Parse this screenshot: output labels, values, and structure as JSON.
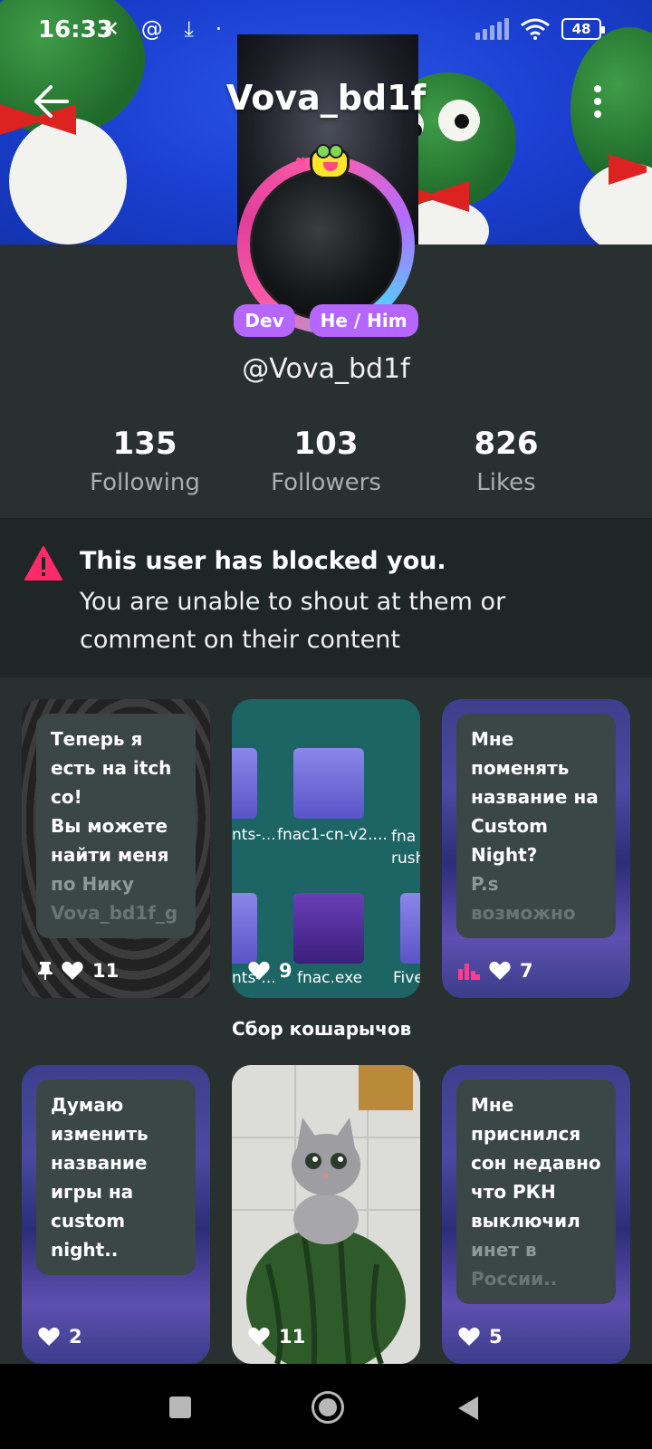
{
  "status_bar": {
    "time": "16:33",
    "left_icons": "✕ @ ⤓ ·",
    "battery": "48"
  },
  "header": {
    "title": "Vova_bd1f"
  },
  "profile": {
    "badges": [
      "Dev",
      "He / Him"
    ],
    "handle": "@Vova_bd1f",
    "stats": [
      {
        "value": "135",
        "label": "Following"
      },
      {
        "value": "103",
        "label": "Followers"
      },
      {
        "value": "826",
        "label": "Likes"
      }
    ]
  },
  "blocked": {
    "title": "This user has blocked you.",
    "message": "You are unable to shout at them or comment on their content",
    "icon": "warning-triangle-icon",
    "color": "#ff2a6a"
  },
  "posts": [
    {
      "lines": [
        "Теперь я",
        "есть на itch",
        "со!",
        "Вы можете",
        "найти меня",
        "по Нику",
        "Vova_bd1f_g"
      ],
      "likes": "11",
      "pinned": true
    },
    {
      "file_labels": [
        "nts-...",
        "fnac1-cn-v2....",
        "fna rush",
        "nts-...",
        "fnac.exe",
        "Five"
      ],
      "likes": "9"
    },
    {
      "lines": [
        "Мне",
        "поменять",
        "название на",
        "Custom",
        "Night?",
        "P.s",
        "возможно"
      ],
      "likes": "7",
      "stats_icon": true
    },
    {
      "lines": [
        "Думаю",
        "изменить",
        "название",
        "игры на",
        "custom",
        "night.."
      ],
      "likes": "2"
    },
    {
      "likes": "11",
      "image": "cat-on-watermelon"
    },
    {
      "lines": [
        "Мне",
        "приснился",
        "сон недавно",
        "что РКН",
        "выключил",
        "инет в",
        "России.."
      ],
      "likes": "5"
    }
  ],
  "collection_label": "Сбор кошарычов",
  "colors": {
    "accent_purple": "#b466ff",
    "background": "#283030",
    "panel": "#1f2626"
  }
}
